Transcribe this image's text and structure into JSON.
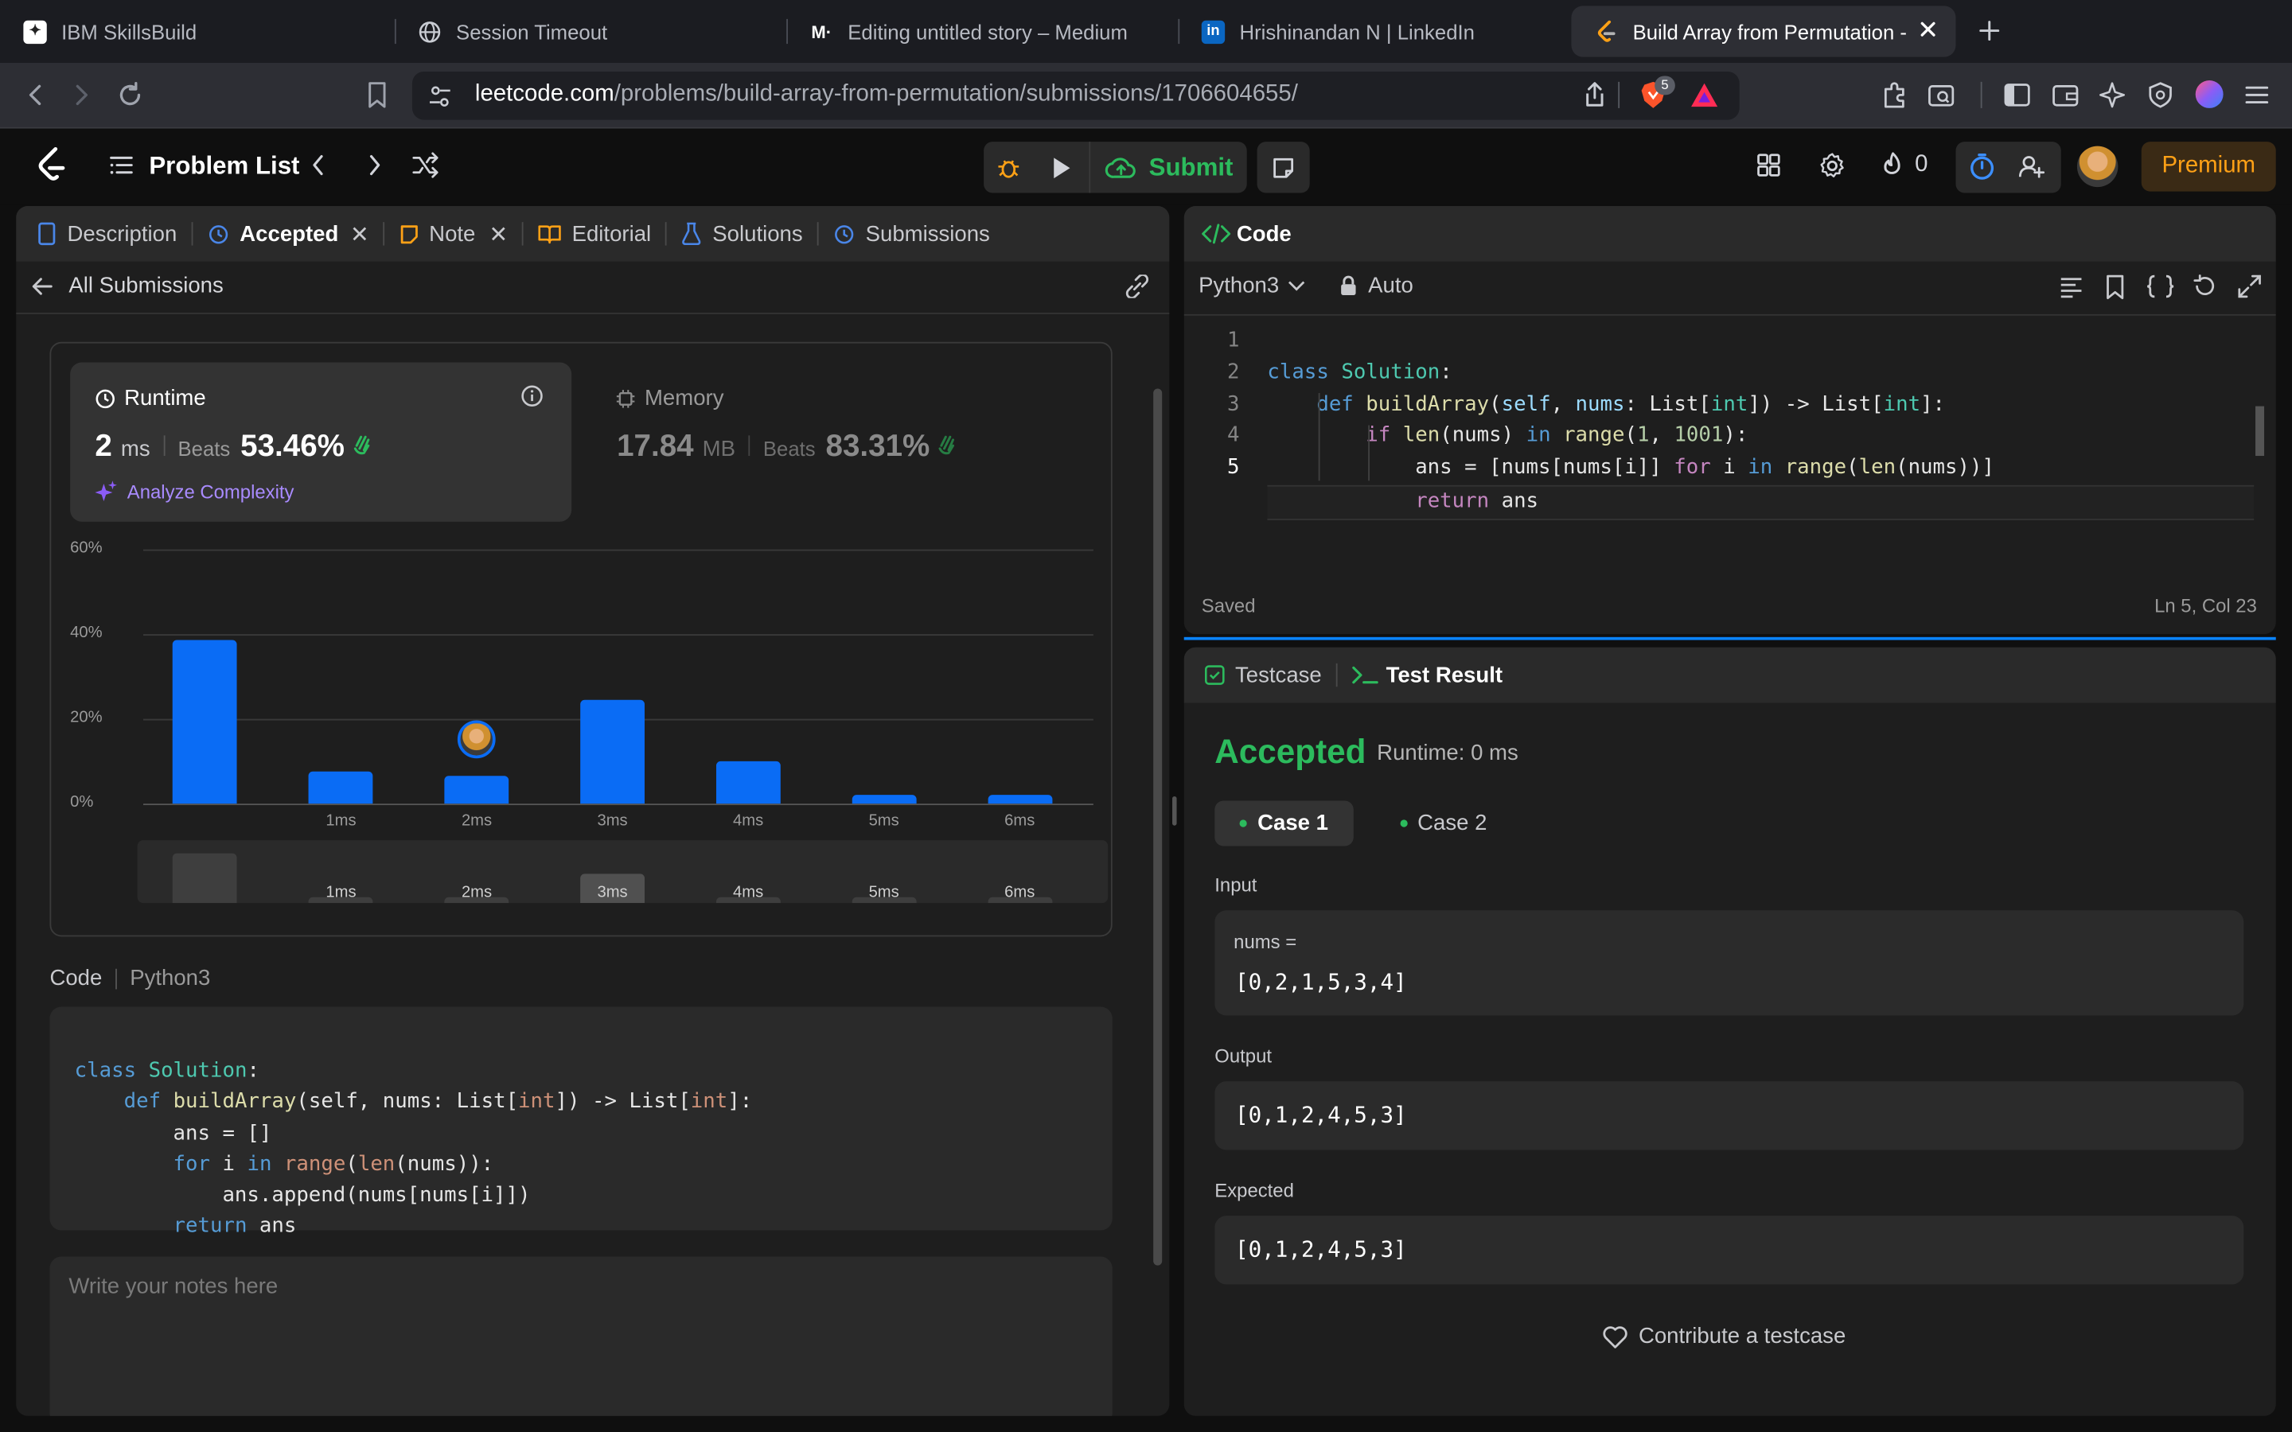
{
  "browser": {
    "tabs": [
      {
        "title": "IBM SkillsBuild",
        "icon": "ibm-icon"
      },
      {
        "title": "Session Timeout",
        "icon": "globe-icon"
      },
      {
        "title": "Editing untitled story – Medium",
        "icon": "medium-icon"
      },
      {
        "title": "Hrishinandan N | LinkedIn",
        "icon": "linkedin-icon"
      },
      {
        "title": "Build Array from Permutation -",
        "icon": "leetcode-icon"
      }
    ],
    "url_domain": "leetcode.com",
    "url_path": "/problems/build-array-from-permutation/submissions/1706604655/",
    "brave_badge": "5"
  },
  "nav": {
    "problem_list": "Problem List",
    "submit": "Submit",
    "streak": "0",
    "premium": "Premium"
  },
  "left": {
    "tabs": [
      {
        "label": "Description"
      },
      {
        "label": "Accepted"
      },
      {
        "label": "Note"
      },
      {
        "label": "Editorial"
      },
      {
        "label": "Solutions"
      },
      {
        "label": "Submissions"
      }
    ],
    "back_label": "All Submissions",
    "runtime": {
      "title": "Runtime",
      "value": "2",
      "unit": "ms",
      "beats_label": "Beats",
      "beats": "53.46%",
      "analyze": "Analyze Complexity"
    },
    "memory": {
      "title": "Memory",
      "value": "17.84",
      "unit": "MB",
      "beats_label": "Beats",
      "beats": "83.31%"
    },
    "code_header": {
      "label": "Code",
      "lang": "Python3"
    },
    "code_lines": [
      "class Solution:",
      "    def buildArray(self, nums: List[int]) -> List[int]:",
      "        ans = []",
      "        for i in range(len(nums)):",
      "            ans.append(nums[nums[i]])",
      "        return ans"
    ],
    "notes_placeholder": "Write your notes here"
  },
  "chart_data": {
    "type": "bar",
    "categories": [
      "",
      "1ms",
      "2ms",
      "3ms",
      "4ms",
      "5ms",
      "6ms"
    ],
    "values": [
      38.5,
      7.5,
      6.5,
      24.5,
      10,
      2,
      2
    ],
    "ylim": [
      0,
      60
    ],
    "yticks": [
      "60%",
      "40%",
      "20%",
      "0%"
    ],
    "ytick_values": [
      60,
      40,
      20,
      0
    ],
    "highlight_category": "2ms",
    "minimap_labels": [
      "",
      "1ms",
      "2ms",
      "3ms",
      "4ms",
      "5ms",
      "6ms"
    ],
    "minimap_values": [
      12,
      1,
      1,
      7,
      1,
      0.3,
      0.3
    ],
    "grid": true,
    "colors": {
      "bar": "#0a6cf5",
      "minimap": "#3e3e3e"
    }
  },
  "right": {
    "code_title": "Code",
    "lang": "Python3",
    "mode": "Auto",
    "editor_lines": [
      "class Solution:",
      "    def buildArray(self, nums: List[int]) -> List[int]:",
      "        if len(nums) in range(1, 1001):",
      "            ans = [nums[nums[i]] for i in range(len(nums))]",
      "            return ans"
    ],
    "line_numbers": [
      "1",
      "2",
      "3",
      "4",
      "5"
    ],
    "saved": "Saved",
    "cursor": "Ln 5, Col 23",
    "test_tabs": {
      "testcase": "Testcase",
      "result": "Test Result"
    },
    "status": "Accepted",
    "runtime": "Runtime: 0 ms",
    "cases": [
      "Case 1",
      "Case 2"
    ],
    "input_label": "Input",
    "input_var": "nums =",
    "input_value": "[0,2,1,5,3,4]",
    "output_label": "Output",
    "output_value": "[0,1,2,4,5,3]",
    "expected_label": "Expected",
    "expected_value": "[0,1,2,4,5,3]",
    "contribute": "Contribute a testcase"
  }
}
